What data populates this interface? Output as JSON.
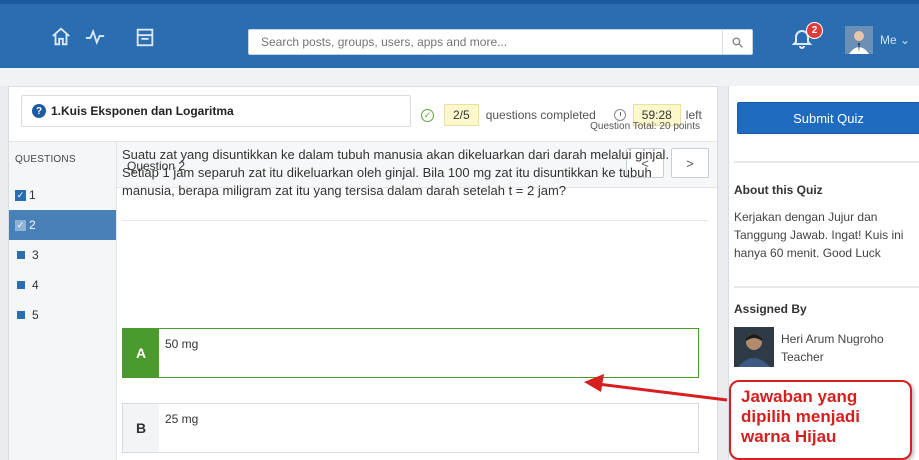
{
  "topbar": {
    "icons": [
      "home-icon",
      "activity-icon",
      "planner-icon"
    ],
    "search_placeholder": "Search posts, groups, users, apps and more...",
    "notification_count": "2",
    "user_label": "Me"
  },
  "quiz": {
    "title": "1.Kuis Eksponen dan Logaritma",
    "completed": "2/5",
    "completed_label": "questions completed",
    "time": "59:28",
    "time_label": "left"
  },
  "sidebar": {
    "heading": "QUESTIONS",
    "items": [
      {
        "label": "1",
        "state": "answered"
      },
      {
        "label": "2",
        "state": "answered-active"
      },
      {
        "label": "3",
        "state": "unanswered"
      },
      {
        "label": "4",
        "state": "unanswered"
      },
      {
        "label": "5",
        "state": "unanswered"
      }
    ]
  },
  "question": {
    "header": "Question 2",
    "prev": "<",
    "next": ">",
    "total": "Question Total: 20 points",
    "text": "Suatu zat yang disuntikkan ke dalam tubuh manusia akan dikeluarkan dari darah melalui ginjal. Setiap 1 jam separuh zat itu dikeluarkan oleh ginjal. Bila 100 mg zat itu disuntikkan ke tubuh manusia, berapa miligram zat itu yang tersisa dalam darah setelah t = 2 jam?",
    "answers": [
      {
        "letter": "A",
        "text": "50 mg",
        "selected": true
      },
      {
        "letter": "B",
        "text": "25 mg",
        "selected": false
      }
    ]
  },
  "right": {
    "submit": "Submit Quiz",
    "about_title": "About this Quiz",
    "about_text": "Kerjakan dengan Jujur dan Tanggung Jawab. Ingat! Kuis ini hanya 60 menit. Good Luck",
    "assigned_title": "Assigned By",
    "teacher_name": "Heri Arum Nugroho",
    "teacher_role": "Teacher"
  },
  "annotation": {
    "text": "Jawaban yang dipilih menjadi warna Hijau",
    "color": "#d62020"
  },
  "colors": {
    "topbar": "#2a6db1",
    "selected": "#4b9a2e",
    "submit": "#1f6bbf"
  }
}
